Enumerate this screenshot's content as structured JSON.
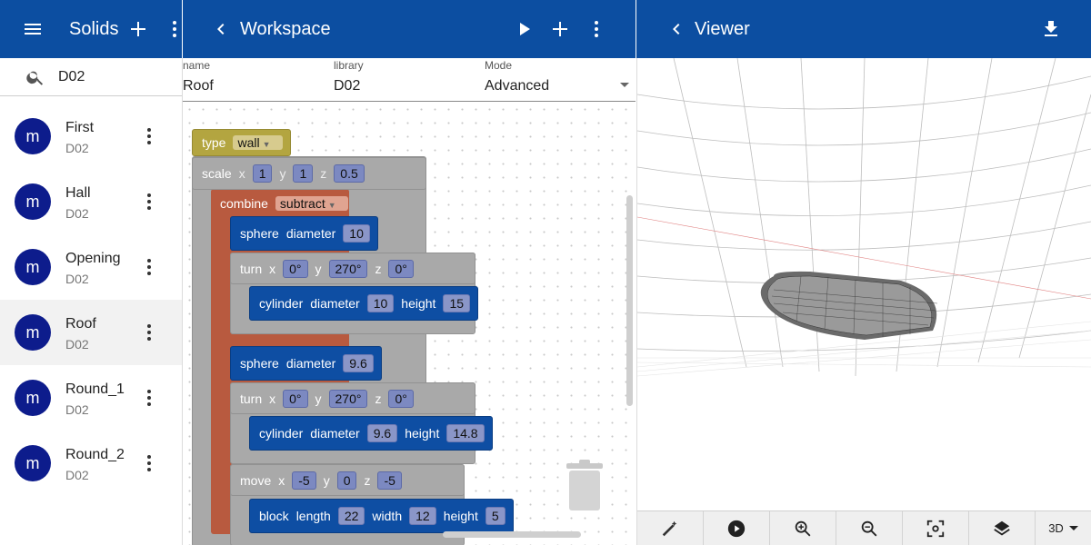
{
  "left": {
    "title": "Solids",
    "search_value": "D02",
    "items": [
      {
        "name": "First",
        "library": "D02",
        "avatar": "m"
      },
      {
        "name": "Hall",
        "library": "D02",
        "avatar": "m"
      },
      {
        "name": "Opening",
        "library": "D02",
        "avatar": "m"
      },
      {
        "name": "Roof",
        "library": "D02",
        "avatar": "m"
      },
      {
        "name": "Round_1",
        "library": "D02",
        "avatar": "m"
      },
      {
        "name": "Round_2",
        "library": "D02",
        "avatar": "m"
      }
    ]
  },
  "workspace": {
    "title": "Workspace",
    "fields": {
      "name_label": "name",
      "name_value": "Roof",
      "library_label": "library",
      "library_value": "D02",
      "mode_label": "Mode",
      "mode_value": "Advanced"
    },
    "blocks": {
      "type_kw": "type",
      "type_val": "wall",
      "scale_kw": "scale",
      "x": "x",
      "y": "y",
      "z": "z",
      "scale_x": "1",
      "scale_y": "1",
      "scale_z": "0.5",
      "combine_kw": "combine",
      "combine_val": "subtract",
      "sphere_kw": "sphere",
      "diameter_kw": "diameter",
      "height_kw": "height",
      "sphere1_d": "10",
      "turn_kw": "turn",
      "turn1_x": "0°",
      "turn1_y": "270°",
      "turn1_z": "0°",
      "cylinder_kw": "cylinder",
      "cyl1_d": "10",
      "cyl1_h": "15",
      "sphere2_d": "9.6",
      "turn2_x": "0°",
      "turn2_y": "270°",
      "turn2_z": "0°",
      "cyl2_d": "9.6",
      "cyl2_h": "14.8",
      "move_kw": "move",
      "move_x": "-5",
      "move_y": "0",
      "move_z": "-5",
      "block_kw": "block",
      "length_kw": "length",
      "width_kw": "width",
      "block_l": "22",
      "block_w": "12",
      "block_h": "5"
    }
  },
  "viewer": {
    "title": "Viewer",
    "view_mode": "3D"
  },
  "colors": {
    "appbar": "#0c4ea1",
    "avatar": "#0d1c8c",
    "block_blue": "#0e4ea3",
    "block_gray": "#a9a9a9",
    "block_red": "#b85a3f",
    "block_yellow": "#b3a540"
  }
}
